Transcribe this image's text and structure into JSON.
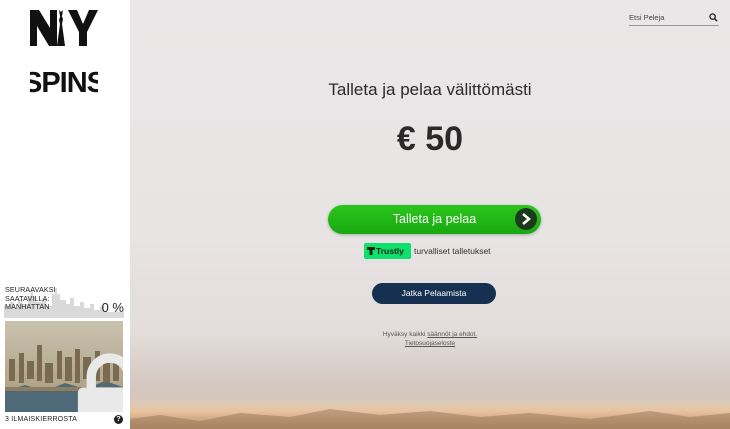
{
  "brand": {
    "logo_top": "NY",
    "logo_bottom": "SPINS"
  },
  "sidebar": {
    "next_label_lines": [
      "SEURAAVAKSI",
      "SAATAVILLA:",
      "MANHATTAN"
    ],
    "progress_text": "0 %",
    "progress_fraction": 0,
    "spins_label": "3 ILMAISKIERROSTA",
    "help_symbol": "?"
  },
  "search": {
    "placeholder": "Etsi Peleja",
    "value": ""
  },
  "main": {
    "headline": "Talleta ja pelaa välittömästi",
    "amount": "€ 50",
    "deposit_button": "Talleta ja pelaa",
    "trustly_brand": "Trustly",
    "trustly_text": "turvalliset talletukset",
    "continue_button": "Jatka Pelaamista",
    "terms_prefix": "Hyväksy kaikki ",
    "terms_link": "säännöt ja ehdot.",
    "privacy_link": "Tietosuojaseloste"
  },
  "colors": {
    "deposit_green": "#1fb818",
    "continue_navy": "#163052",
    "trustly_green": "#0ee06e",
    "text_dark": "#2a2a2a"
  },
  "icons": {
    "search": "search-icon",
    "chevron": "chevron-right-icon",
    "lock": "lock-icon",
    "help": "help-icon",
    "trustly": "trustly-logo-icon"
  }
}
